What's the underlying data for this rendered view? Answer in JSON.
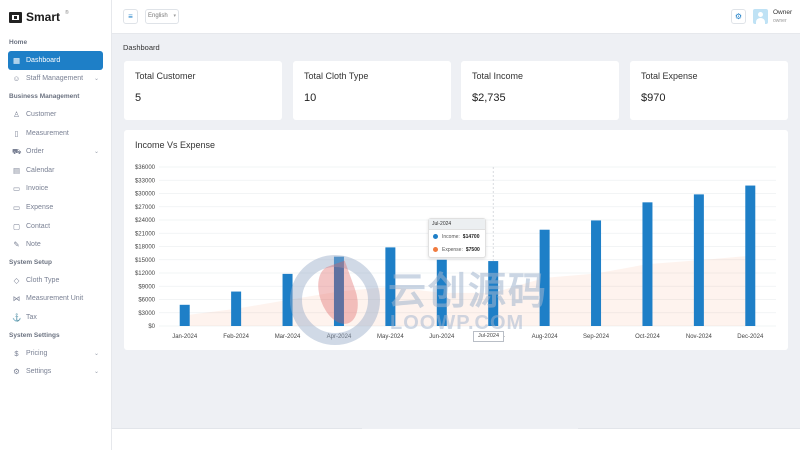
{
  "app": {
    "name": "Smart",
    "trademark": "®"
  },
  "sidebar": {
    "sections": [
      {
        "title": "Home",
        "items": [
          {
            "label": "Dashboard",
            "icon": "grid-icon",
            "active": true,
            "chevron": false
          }
        ]
      },
      {
        "title": "",
        "items": [
          {
            "label": "Staff Management",
            "icon": "users-icon",
            "active": false,
            "chevron": true
          }
        ]
      },
      {
        "title": "Business Management",
        "items": [
          {
            "label": "Customer",
            "icon": "user-check-icon",
            "active": false,
            "chevron": false
          },
          {
            "label": "Measurement",
            "icon": "bookmark-icon",
            "active": false,
            "chevron": false
          },
          {
            "label": "Order",
            "icon": "cart-icon",
            "active": false,
            "chevron": true
          },
          {
            "label": "Calendar",
            "icon": "calendar-icon",
            "active": false,
            "chevron": false
          },
          {
            "label": "Invoice",
            "icon": "file-icon",
            "active": false,
            "chevron": false
          },
          {
            "label": "Expense",
            "icon": "file-icon",
            "active": false,
            "chevron": false
          },
          {
            "label": "Contact",
            "icon": "contact-icon",
            "active": false,
            "chevron": false
          },
          {
            "label": "Note",
            "icon": "note-icon",
            "active": false,
            "chevron": false
          }
        ]
      },
      {
        "title": "System Setup",
        "items": [
          {
            "label": "Cloth Type",
            "icon": "shield-icon",
            "active": false,
            "chevron": false
          },
          {
            "label": "Measurement Unit",
            "icon": "share-icon",
            "active": false,
            "chevron": false
          },
          {
            "label": "Tax",
            "icon": "anchor-icon",
            "active": false,
            "chevron": false
          }
        ]
      },
      {
        "title": "System Settings",
        "items": [
          {
            "label": "Pricing",
            "icon": "dollar-icon",
            "active": false,
            "chevron": true
          },
          {
            "label": "Settings",
            "icon": "gear-icon",
            "active": false,
            "chevron": true
          }
        ]
      }
    ]
  },
  "topbar": {
    "language": "English",
    "user": {
      "name": "Owner",
      "role": "owner"
    }
  },
  "breadcrumb": "Dashboard",
  "cards": [
    {
      "label": "Total Customer",
      "value": "5"
    },
    {
      "label": "Total Cloth Type",
      "value": "10"
    },
    {
      "label": "Total Income",
      "value": "$2,735"
    },
    {
      "label": "Total Expense",
      "value": "$970"
    }
  ],
  "chart": {
    "title": "Income Vs Expense"
  },
  "tooltip": {
    "title": "Jul-2024",
    "rows": [
      {
        "label": "Income:",
        "value": "$14700",
        "color": "#1e7fc7"
      },
      {
        "label": "Expense:",
        "value": "$7500",
        "color": "#f07b3f"
      }
    ],
    "x_label": "Jul-2024"
  },
  "watermark": {
    "cn": "云创源码",
    "en": "LOOWP.COM"
  },
  "chart_data": {
    "type": "bar",
    "title": "Income Vs Expense",
    "categories": [
      "Jan-2024",
      "Feb-2024",
      "Mar-2024",
      "Apr-2024",
      "May-2024",
      "Jun-2024",
      "Jul-2024",
      "Aug-2024",
      "Sep-2024",
      "Oct-2024",
      "Nov-2024",
      "Dec-2024"
    ],
    "series": [
      {
        "name": "Income",
        "color": "#1e7fc7",
        "values": [
          4800,
          7800,
          11800,
          15700,
          17800,
          15000,
          14700,
          21800,
          23900,
          28000,
          29800,
          31800
        ]
      },
      {
        "name": "Expense",
        "color": "#f07b3f",
        "values": [
          2400,
          3900,
          5900,
          7800,
          8900,
          7500,
          7500,
          10900,
          11900,
          14000,
          14900,
          15900
        ]
      }
    ],
    "yticks": [
      "$0",
      "$3000",
      "$6000",
      "$9000",
      "$12000",
      "$15000",
      "$18000",
      "$21000",
      "$24000",
      "$27000",
      "$30000",
      "$33000",
      "$36000"
    ],
    "ylim": [
      0,
      36000
    ],
    "grid": true,
    "legend": "tooltip"
  }
}
